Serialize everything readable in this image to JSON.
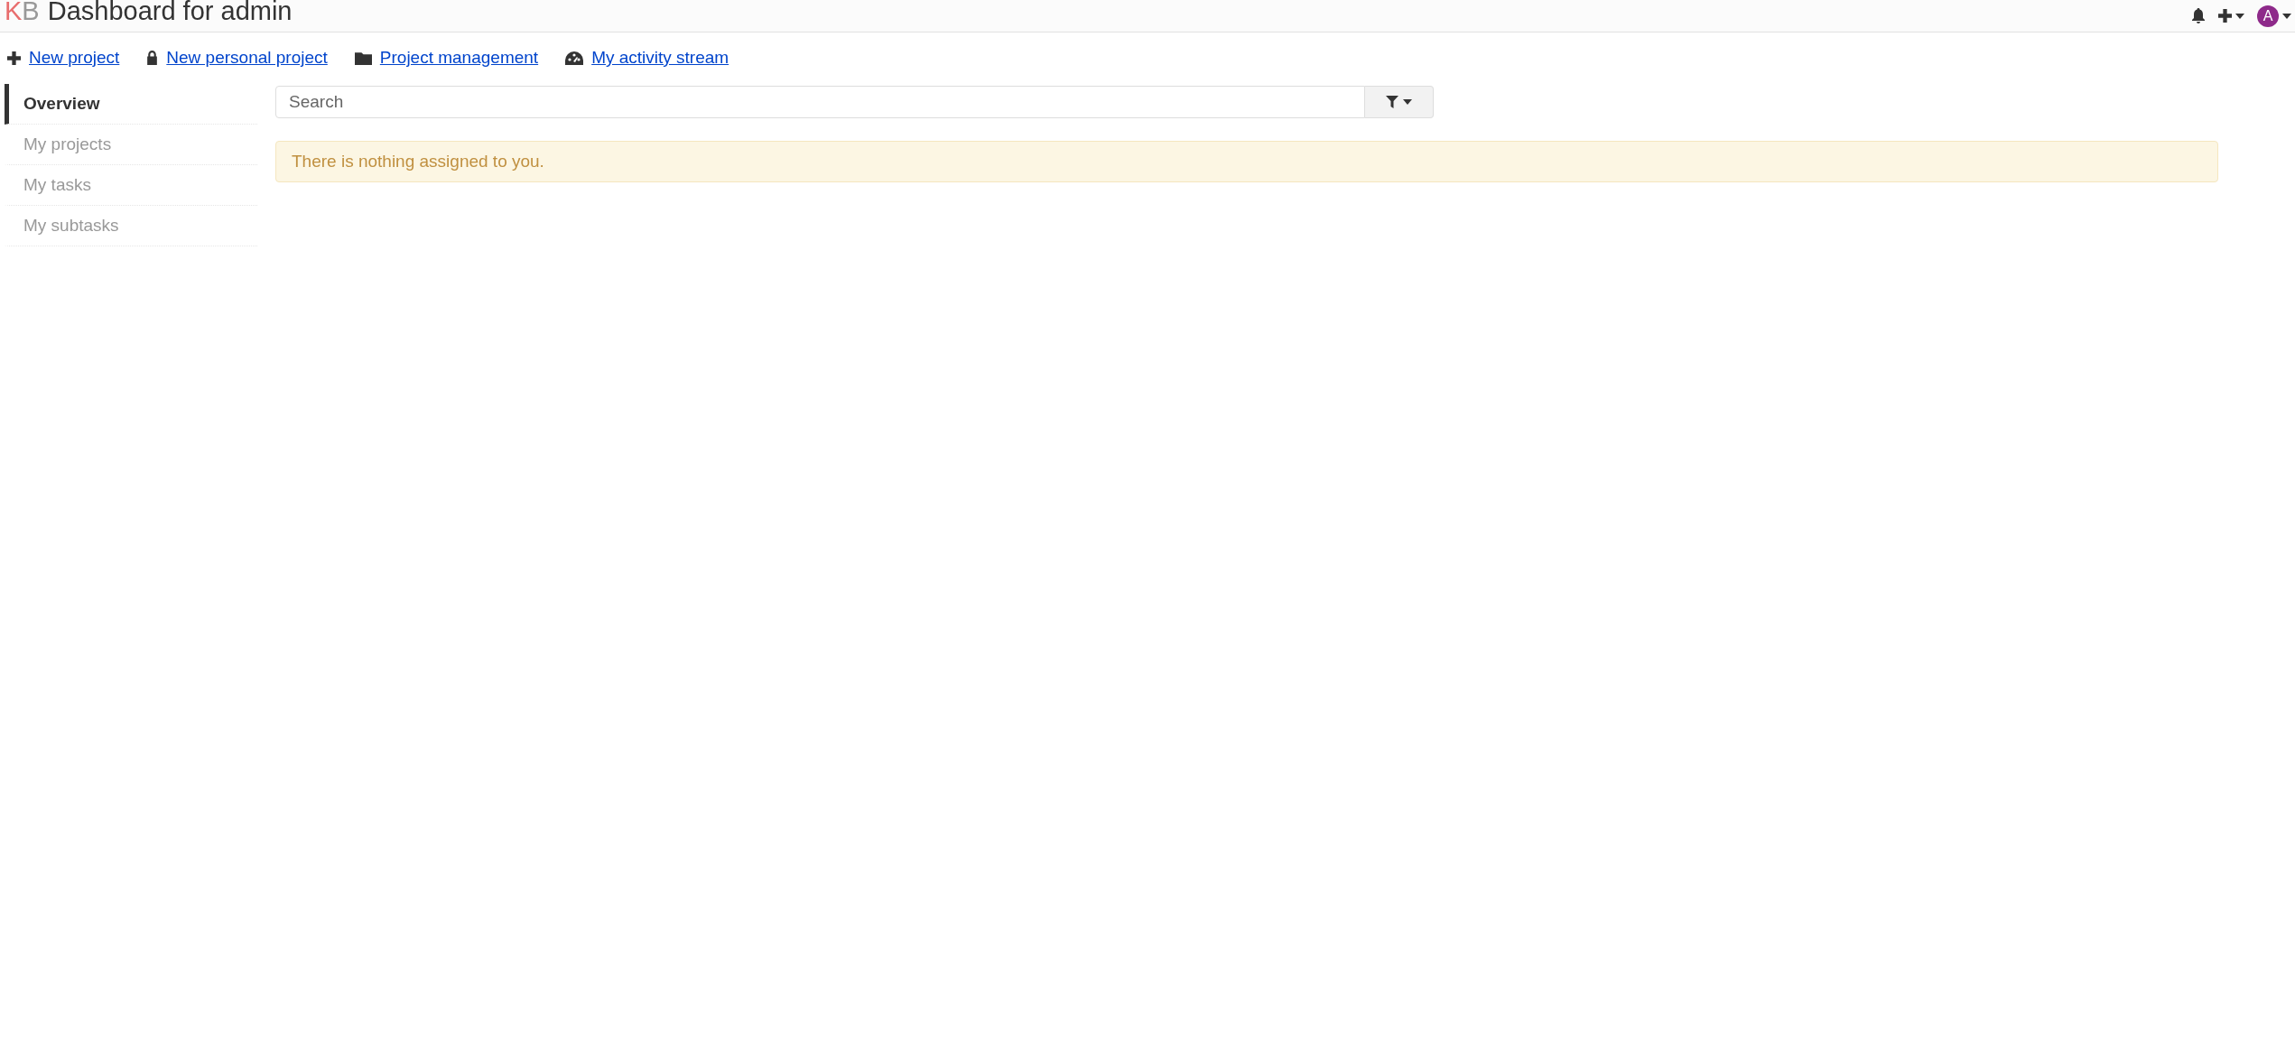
{
  "header": {
    "logo_letters": [
      {
        "text": "K",
        "color": "#e86d6d"
      },
      {
        "text": "B",
        "color": "#999999"
      }
    ],
    "title": "Dashboard for admin",
    "avatar": {
      "letter": "A",
      "color": "#8e2a8a"
    }
  },
  "actions": [
    {
      "kind": "plus",
      "label": "New project"
    },
    {
      "kind": "lock",
      "label": "New personal project"
    },
    {
      "kind": "folder",
      "label": "Project management"
    },
    {
      "kind": "gauge",
      "label": "My activity stream"
    }
  ],
  "sidebar": {
    "items": [
      {
        "label": "Overview",
        "selected": true
      },
      {
        "label": "My projects",
        "selected": false
      },
      {
        "label": "My tasks",
        "selected": false
      },
      {
        "label": "My subtasks",
        "selected": false
      }
    ]
  },
  "search": {
    "placeholder": "Search"
  },
  "alert": {
    "text": "There is nothing assigned to you."
  }
}
